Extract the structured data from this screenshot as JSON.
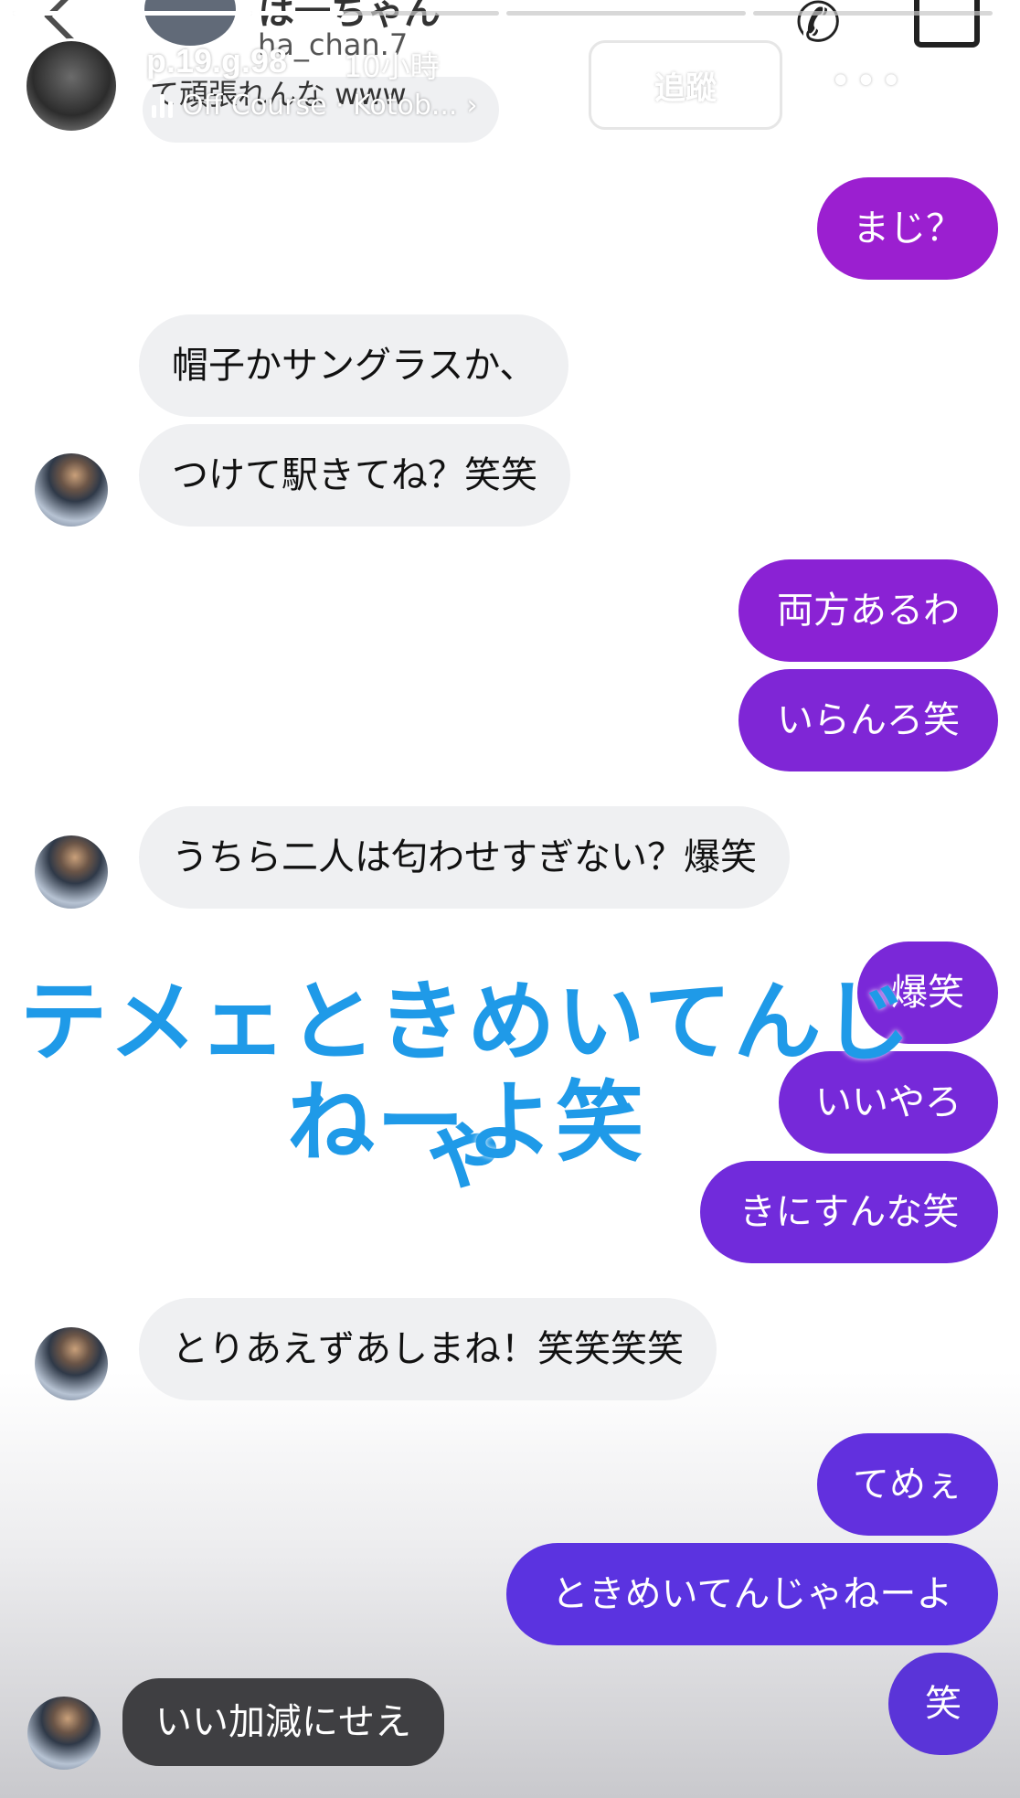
{
  "story": {
    "username": "p.19.g.98",
    "time_ago": "10小時",
    "music": "Off Course · Kotob...",
    "follow_label": "追蹤",
    "more_label": "•••",
    "progress": [
      1.0,
      0.35,
      0.0,
      0.0
    ]
  },
  "dm": {
    "contact_name": "は一ちゃん",
    "contact_handle": "ha_chan.7",
    "previous_message": "て頑張れんな www"
  },
  "messages": [
    {
      "side": "out",
      "text": "まじ？"
    },
    {
      "side": "in",
      "text": "帽子かサングラスか、"
    },
    {
      "side": "in",
      "text": "つけて駅きてね？笑笑"
    },
    {
      "side": "out",
      "text": "両方あるわ"
    },
    {
      "side": "out",
      "text": "いらんろ笑"
    },
    {
      "side": "in",
      "text": "うちら二人は匂わせすぎない？爆笑"
    },
    {
      "side": "out",
      "text": "爆笑"
    },
    {
      "side": "out",
      "text": "いいやろ"
    },
    {
      "side": "out",
      "text": "きにすんな笑"
    },
    {
      "side": "in",
      "text": "とりあえずあしまね！笑笑笑笑"
    },
    {
      "side": "out",
      "text": "てめぇ"
    },
    {
      "side": "out",
      "text": "ときめいてんじゃねーよ"
    },
    {
      "side": "out",
      "text": "笑"
    }
  ],
  "overlay_caption": {
    "line1": "テメェときめいてんじゃ",
    "line2": "ねーよ笑"
  },
  "reply": {
    "text": "いい加減にせえ"
  },
  "colors": {
    "incoming": "#eff0f2",
    "outgoing_top": "#9b1fd0",
    "outgoing_bottom": "#5a33e0",
    "caption": "#1f9ae8",
    "reply_bubble": "#3f3f42"
  }
}
